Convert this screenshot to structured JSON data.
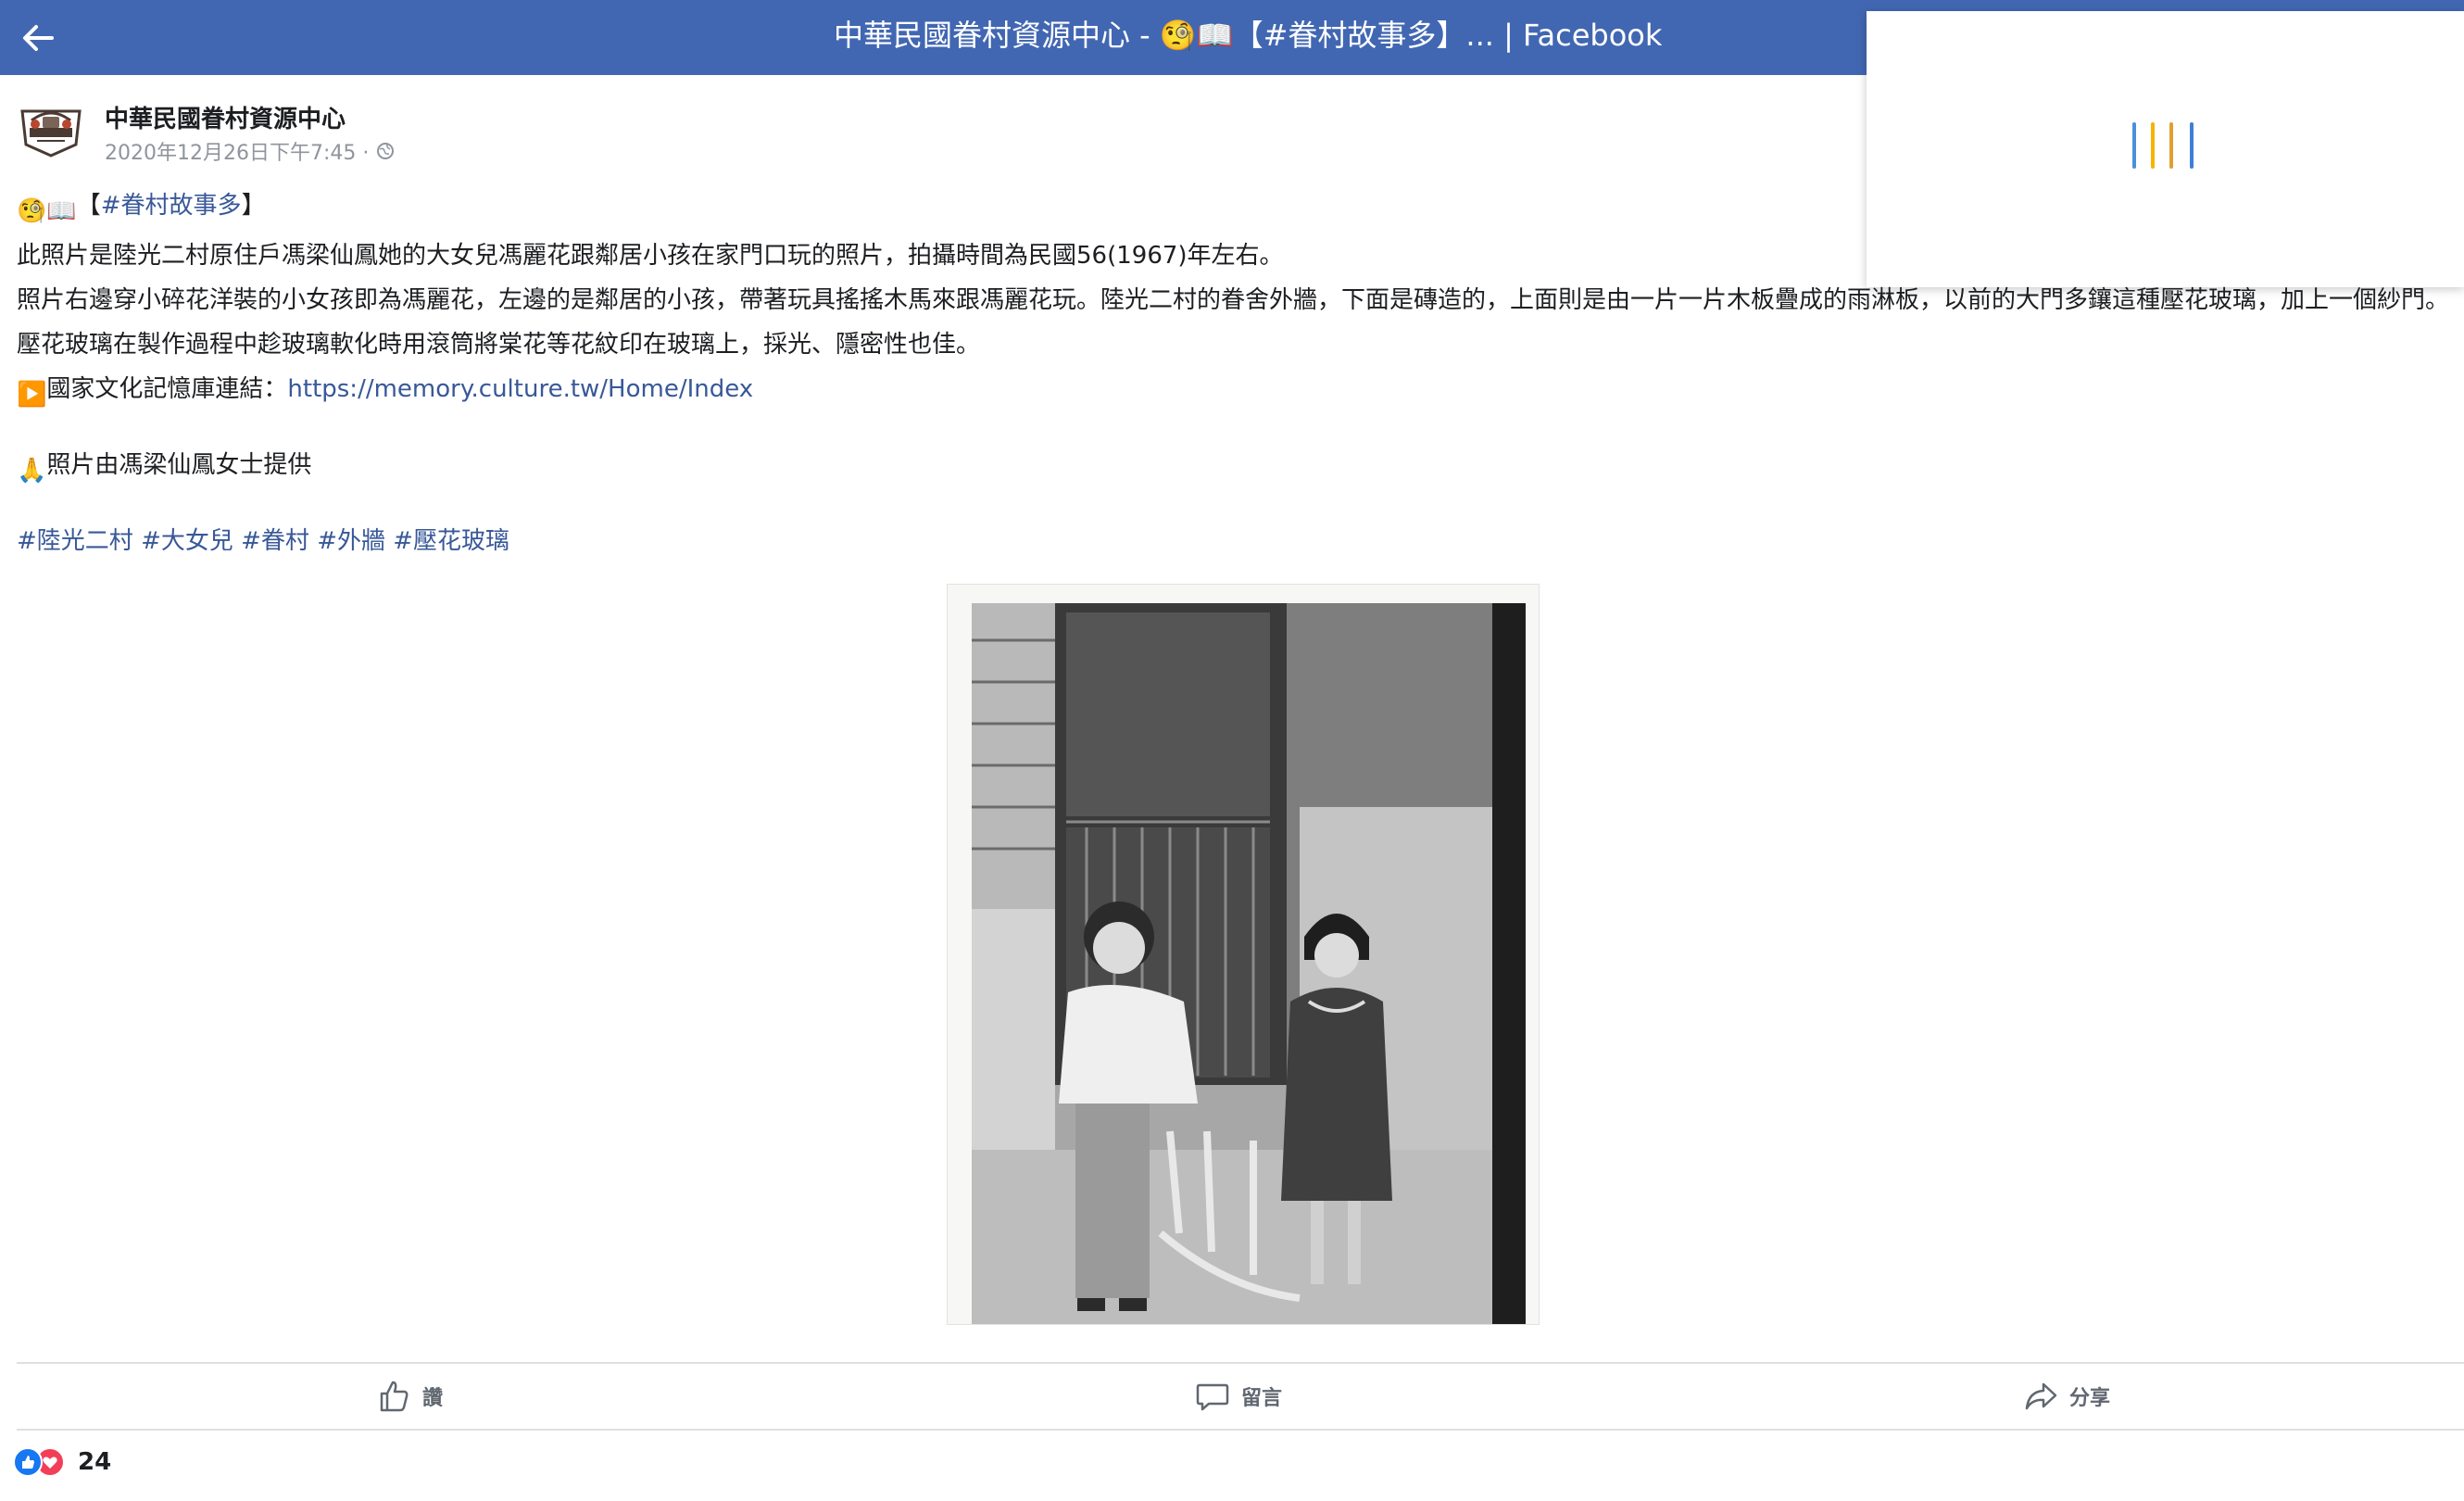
{
  "topbar": {
    "title": "中華民國眷村資源中心 - 🧐📖【#眷村故事多】... | Facebook"
  },
  "post": {
    "page_name": "中華民國眷村資源中心",
    "timestamp": "2020年12月26日下午7:45 ·",
    "headline_emoji": "🧐📖",
    "headline_open": "【",
    "headline_tag": "#眷村故事多",
    "headline_close": "】",
    "para1": "此照片是陸光二村原住戶馮梁仙鳳她的大女兒馮麗花跟鄰居小孩在家門口玩的照片，拍攝時間為民國56(1967)年左右。",
    "para2": "照片右邊穿小碎花洋裝的小女孩即為馮麗花，左邊的是鄰居的小孩，帶著玩具搖搖木馬來跟馮麗花玩。陸光二村的眷舍外牆，下面是磚造的，上面則是由一片一片木板疊成的雨淋板，以前的大門多鑲這種壓花玻璃，加上一個紗門。",
    "para3": "壓花玻璃在製作過程中趁玻璃軟化時用滾筒將棠花等花紋印在玻璃上，採光、隱密性也佳。",
    "link_emoji": "▶️",
    "link_label": "國家文化記憶庫連結：",
    "link_url": "https://memory.culture.tw/Home/Index",
    "credit_emoji": "🙏",
    "credit_text": "照片由馮梁仙鳳女士提供",
    "hashtags": [
      "#陸光二村",
      "#大女兒",
      "#眷村",
      "#外牆",
      "#壓花玻璃"
    ]
  },
  "actions": {
    "like_label": "讚",
    "comment_label": "留言",
    "share_label": "分享"
  },
  "reactions": {
    "count": "24"
  },
  "colors": {
    "brand": "#4267b2",
    "link": "#385898",
    "like": "#1877f2",
    "love": "#f33e58"
  },
  "icons": {
    "back": "arrow-left-icon",
    "privacy": "globe-icon",
    "like": "thumbs-up-icon",
    "comment": "comment-bubble-icon",
    "share": "share-arrow-icon"
  }
}
